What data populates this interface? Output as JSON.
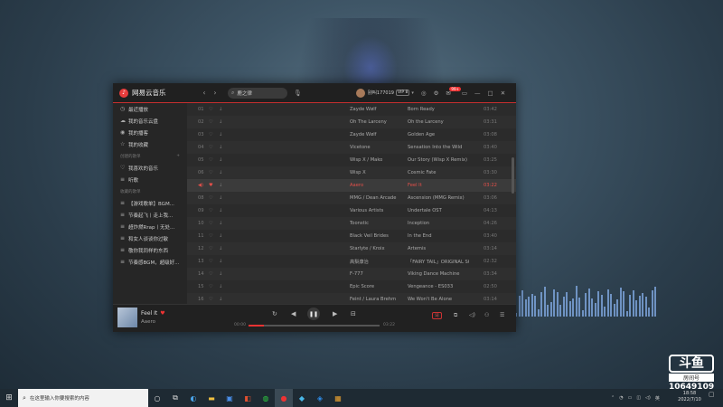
{
  "app": {
    "name": "网易云音乐",
    "nav_back": "‹",
    "nav_forward": "›",
    "search_value": "鹿之律",
    "user_name": "别叫177019",
    "vip_label": "VIP 8",
    "mail_badge": "99+"
  },
  "sidebar": {
    "items_top": [
      {
        "icon": "◷",
        "label": "最近播放"
      },
      {
        "icon": "☁",
        "label": "我的音乐云盘"
      },
      {
        "icon": "◉",
        "label": "我的播客"
      },
      {
        "icon": "☆",
        "label": "我的收藏"
      }
    ],
    "created_head": "创建的歌单",
    "created": [
      {
        "icon": "♡",
        "label": "我喜欢的音乐"
      },
      {
        "icon": "≡",
        "label": "听歌"
      }
    ],
    "collected_head": "收藏的歌单",
    "collected": [
      {
        "icon": "≡",
        "label": "【游戏歌单】BGM..."
      },
      {
        "icon": "≡",
        "label": "节奏起飞丨走上我..."
      },
      {
        "icon": "≡",
        "label": "超炸燃Rrap丨无处..."
      },
      {
        "icon": "≡",
        "label": "和女人谈谈你过敏"
      },
      {
        "icon": "≡",
        "label": "敬你我同样的东西"
      },
      {
        "icon": "≡",
        "label": "节奏感BGM，超级好..."
      }
    ]
  },
  "tracks": [
    {
      "num": "01",
      "title": "Heroes",
      "tag": "SQ",
      "artist": "Zayde Wølf",
      "album": "Born Ready",
      "duration": "03:42"
    },
    {
      "num": "02",
      "title": "Man on a Mission",
      "tag": "SQ",
      "artist": "Oh The Larceny",
      "album": "Oh the Larceny",
      "duration": "03:31"
    },
    {
      "num": "03",
      "title": "Born Ready",
      "tag": "SQ",
      "artist": "Zayde Wølf",
      "album": "Golden Age",
      "duration": "03:08"
    },
    {
      "num": "04",
      "title": "Tremble",
      "tag": "MV",
      "artist": "Vicetone",
      "album": "Sensation Into the Wild",
      "duration": "03:40"
    },
    {
      "num": "05",
      "title": "Our Story (Wisp X Remix)",
      "tag": "",
      "artist": "Wisp X / Mako",
      "album": "Our Story (Wisp X Remix)",
      "duration": "03:25"
    },
    {
      "num": "06",
      "title": "Cosmic Fate",
      "tag": "SQ",
      "artist": "Wisp X",
      "album": "Cosmic Fate",
      "duration": "03:30"
    },
    {
      "num": "07",
      "title": "Feel It",
      "tag": "SQ",
      "artist": "Aaero",
      "album": "Feel It",
      "duration": "03:22"
    },
    {
      "num": "08",
      "title": "Ascension (Remix)",
      "tag": "",
      "artist": "MMG / Dean Arcade",
      "album": "Ascension (MMG Remix)",
      "duration": "03:06"
    },
    {
      "num": "09",
      "title": "Megalovania Dual Mix",
      "tag": "",
      "artist": "Various Artists",
      "album": "Undertale OST",
      "duration": "04:13"
    },
    {
      "num": "10",
      "title": "Aspiration",
      "tag": "SQ",
      "artist": "Toonstic",
      "album": "Inception",
      "duration": "04:26"
    },
    {
      "num": "11",
      "title": "In the End",
      "tag": "SQ",
      "artist": "Black Veil Brides",
      "album": "In the End",
      "duration": "03:40"
    },
    {
      "num": "12",
      "title": "Artemis",
      "tag": "SQ",
      "artist": "Starlyte / Kroix",
      "album": "Artemis",
      "duration": "03:14"
    },
    {
      "num": "13",
      "title": "FAIRY TAIL メインテーマ",
      "tag": "SQ",
      "artist": "高梨康治",
      "album": "「FAIRY TAIL」ORIGINAL SO...",
      "duration": "02:32"
    },
    {
      "num": "14",
      "title": "Dance of The Violins 2",
      "tag": "SQ",
      "artist": "F-777",
      "album": "Viking Dance Machine",
      "duration": "03:34"
    },
    {
      "num": "15",
      "title": "Liberators",
      "tag": "SQ",
      "artist": "Epic Score",
      "album": "Vengeance - ES033",
      "duration": "02:50"
    },
    {
      "num": "16",
      "title": "We Won't Be Alone (feat. Laura Brehm)",
      "tag": "",
      "artist": "Feint / Laura Brehm",
      "album": "We Won't Be Alone",
      "duration": "03:14"
    }
  ],
  "active_index": 6,
  "player": {
    "title": "Feel It",
    "artist": "Aaero",
    "current_time": "00:00",
    "total_time": "03:22",
    "progress": 0.12,
    "lyrics_label": "词",
    "heart": "♥"
  },
  "watermark": {
    "brand": "斗鱼",
    "room_label": "房间号",
    "room_number": "10649109"
  },
  "taskbar": {
    "search_placeholder": "在这里输入你要搜索的内容",
    "time": "18:58",
    "date": "2022/7/10",
    "lang": "英"
  }
}
